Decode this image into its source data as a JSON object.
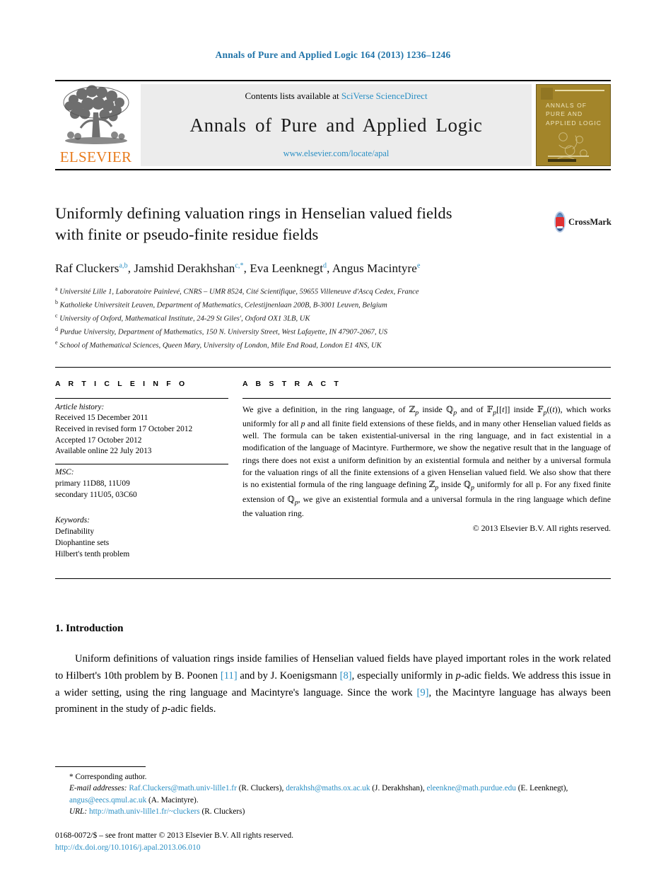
{
  "running_head": "Annals of Pure and Applied Logic 164 (2013) 1236–1246",
  "masthead": {
    "publisher_name": "ELSEVIER",
    "contents_prefix": "Contents lists available at ",
    "contents_link": "SciVerse ScienceDirect",
    "journal_title": "Annals of Pure and Applied Logic",
    "journal_url": "www.elsevier.com/locate/apal",
    "cover_title": "ANNALS OF PURE AND APPLIED LOGIC",
    "cover_color": "#a3852a",
    "link_color": "#2a8fc4"
  },
  "crossmark": {
    "label": "CrossMark"
  },
  "article": {
    "title_line1": "Uniformly defining valuation rings in Henselian valued fields",
    "title_line2": "with finite or pseudo-finite residue fields",
    "authors": [
      {
        "name": "Raf Cluckers",
        "marks": "a,b"
      },
      {
        "name": "Jamshid Derakhshan",
        "marks": "c,*"
      },
      {
        "name": "Eva Leenknegt",
        "marks": "d"
      },
      {
        "name": "Angus Macintyre",
        "marks": "e"
      }
    ],
    "affiliations": [
      {
        "mark": "a",
        "text": "Université Lille 1, Laboratoire Painlevé, CNRS – UMR 8524, Cité Scientifique, 59655 Villeneuve d'Ascq Cedex, France"
      },
      {
        "mark": "b",
        "text": "Katholieke Universiteit Leuven, Department of Mathematics, Celestijnenlaan 200B, B-3001 Leuven, Belgium"
      },
      {
        "mark": "c",
        "text": "University of Oxford, Mathematical Institute, 24-29 St Giles', Oxford OX1 3LB, UK"
      },
      {
        "mark": "d",
        "text": "Purdue University, Department of Mathematics, 150 N. University Street, West Lafayette, IN 47907-2067, US"
      },
      {
        "mark": "e",
        "text": "School of Mathematical Sciences, Queen Mary, University of London, Mile End Road, London E1 4NS, UK"
      }
    ]
  },
  "info": {
    "heading": "A R T I C L E    I N F O",
    "history_label": "Article history:",
    "history": [
      "Received 15 December 2011",
      "Received in revised form 17 October 2012",
      "Accepted 17 October 2012",
      "Available online 22 July 2013"
    ],
    "msc_label": "MSC:",
    "msc": [
      "primary 11D88, 11U09",
      "secondary 11U05, 03C60"
    ],
    "keywords_label": "Keywords:",
    "keywords": [
      "Definability",
      "Diophantine sets",
      "Hilbert's tenth problem"
    ]
  },
  "abstract": {
    "heading": "A B S T R A C T",
    "text": "We give a definition, in the ring language, of ℤ_p inside ℚ_p and of 𝔽_p[[t]] inside 𝔽_p((t)), which works uniformly for all p and all finite field extensions of these fields, and in many other Henselian valued fields as well. The formula can be taken existential-universal in the ring language, and in fact existential in a modification of the language of Macintyre. Furthermore, we show the negative result that in the language of rings there does not exist a uniform definition by an existential formula and neither by a universal formula for the valuation rings of all the finite extensions of a given Henselian valued field. We also show that there is no existential formula of the ring language defining ℤ_p inside ℚ_p uniformly for all p. For any fixed finite extension of ℚ_p, we give an existential formula and a universal formula in the ring language which define the valuation ring.",
    "copyright": "© 2013 Elsevier B.V. All rights reserved."
  },
  "section": {
    "number_title": "1. Introduction",
    "paragraph": "Uniform definitions of valuation rings inside families of Henselian valued fields have played important roles in the work related to Hilbert's 10th problem by B. Poonen [11] and by J. Koenigsmann [8], especially uniformly in p-adic fields. We address this issue in a wider setting, using the ring language and Macintyre's language. Since the work [9], the Macintyre language has always been prominent in the study of p-adic fields.",
    "refs": {
      "poonen": "[11]",
      "koenigsmann": "[8]",
      "macintyre": "[9]"
    }
  },
  "footnotes": {
    "corresponding": "*  Corresponding author.",
    "email_label": "E-mail addresses:",
    "emails": [
      {
        "addr": "Raf.Cluckers@math.univ-lille1.fr",
        "who": "(R. Cluckers)"
      },
      {
        "addr": "derakhsh@maths.ox.ac.uk",
        "who": "(J. Derakhshan)"
      },
      {
        "addr": "eleenkne@math.purdue.edu",
        "who": "(E. Leenknegt)"
      },
      {
        "addr": "angus@eecs.qmul.ac.uk",
        "who": "(A. Macintyre)"
      }
    ],
    "url_label": "URL:",
    "url": "http://math.univ-lille1.fr/~cluckers",
    "url_who": "(R. Cluckers)",
    "issn_line": "0168-0072/$ – see front matter  © 2013 Elsevier B.V. All rights reserved.",
    "doi": "http://dx.doi.org/10.1016/j.apal.2013.06.010"
  }
}
